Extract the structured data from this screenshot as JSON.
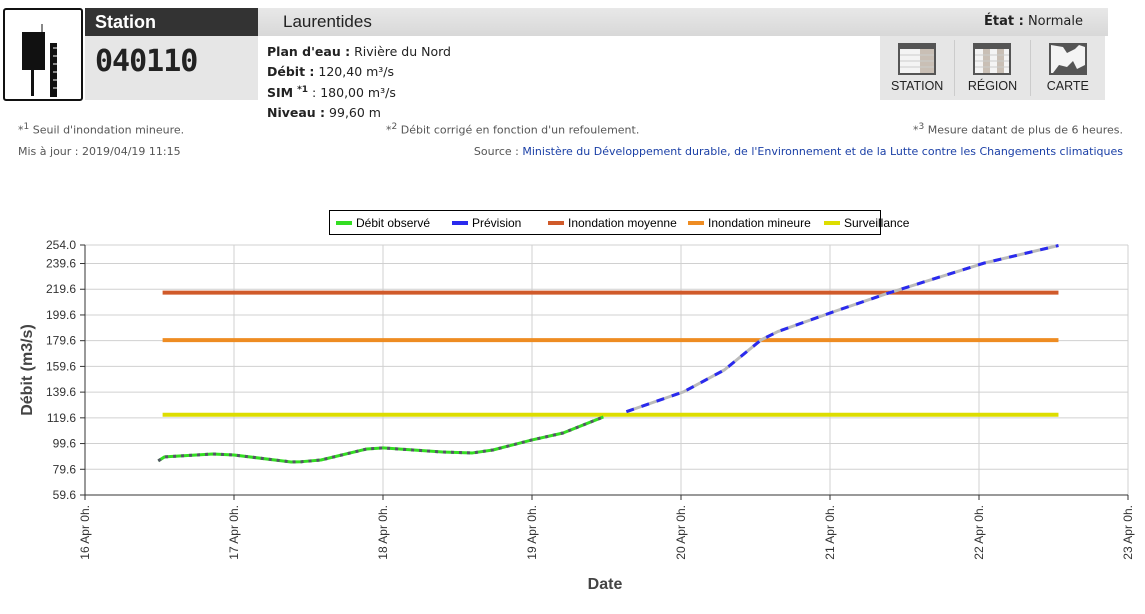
{
  "header": {
    "station_label": "Station",
    "station_number": "040110",
    "region": "Laurentides",
    "etat_label": "État :",
    "etat_value": "Normale"
  },
  "info": {
    "plan_label": "Plan d'eau :",
    "plan_value": "Rivière du Nord",
    "debit_label": "Débit :",
    "debit_value": "120,40 m³/s",
    "sim_label": "SIM",
    "sim_sup": "*1",
    "sim_value": ": 180,00 m³/s",
    "niveau_label": "Niveau :",
    "niveau_value": "99,60 m"
  },
  "buttons": [
    {
      "label": "STATION",
      "icon": "table-icon"
    },
    {
      "label": "RÉGION",
      "icon": "table-icon"
    },
    {
      "label": "CARTE",
      "icon": "map-icon"
    }
  ],
  "notes": {
    "n1_star": "*",
    "n1_sup": "1",
    "n1_text": "Seuil d'inondation mineure.",
    "n2_star": "*",
    "n2_sup": "2",
    "n2_text": "Débit corrigé en fonction d'un refoulement.",
    "n3_star": "*",
    "n3_sup": "3",
    "n3_text": "Mesure datant de plus de 6 heures.",
    "updated": "Mis à jour : 2019/04/19 11:15",
    "source_label": "Source :",
    "source_link": "Ministère du Développement durable, de l'Environnement et de la Lutte contre les Changements climatiques"
  },
  "chart_data": {
    "type": "line",
    "xlabel": "Date",
    "ylabel": "Débit (m3/s)",
    "ylim": [
      59.6,
      254.0
    ],
    "yticks": [
      "254.0",
      "239.6",
      "219.6",
      "199.6",
      "179.6",
      "159.6",
      "139.6",
      "119.6",
      "99.6",
      "79.6",
      "59.6"
    ],
    "xticks": [
      "16 Apr 0h.",
      "17 Apr 0h.",
      "18 Apr 0h.",
      "19 Apr 0h.",
      "20 Apr 0h.",
      "21 Apr 0h.",
      "22 Apr 0h.",
      "23 Apr 0h."
    ],
    "x_unit": "hours since 16 Apr 0h",
    "xlim": [
      0,
      168
    ],
    "grid": true,
    "legend_position": "top-center",
    "series": [
      {
        "name": "Débit observé",
        "color": "#33dd22",
        "dash": "#555566",
        "x": [
          11.8,
          12.8,
          20.6,
          24,
          33.2,
          34.9,
          38,
          45.4,
          48,
          57.6,
          62.4,
          65.7,
          72,
          77,
          83.5
        ],
        "y": [
          86.1,
          89.2,
          91.5,
          90.7,
          85.3,
          85.5,
          86.8,
          95.4,
          96.2,
          93,
          92.3,
          94.6,
          102.4,
          107.8,
          120.3
        ]
      },
      {
        "name": "Prévision",
        "color": "#2a2aee",
        "dash": "#bbbbbb",
        "x": [
          87.2,
          96.5,
          103,
          108.9,
          111.6,
          120.7,
          129.4,
          144.8,
          156.8
        ],
        "y": [
          124.4,
          140,
          156.9,
          180.2,
          186.7,
          202.3,
          216.6,
          239.9,
          253.6
        ]
      },
      {
        "name": "Inondation moyenne",
        "color": "#d05a2a",
        "x": [
          12.5,
          156.8
        ],
        "y": [
          217,
          217
        ]
      },
      {
        "name": "Inondation mineure",
        "color": "#ee8c22",
        "x": [
          12.5,
          156.8
        ],
        "y": [
          180,
          180
        ]
      },
      {
        "name": "Surveillance",
        "color": "#dddd00",
        "x": [
          12.5,
          156.8
        ],
        "y": [
          122,
          122
        ]
      }
    ]
  }
}
